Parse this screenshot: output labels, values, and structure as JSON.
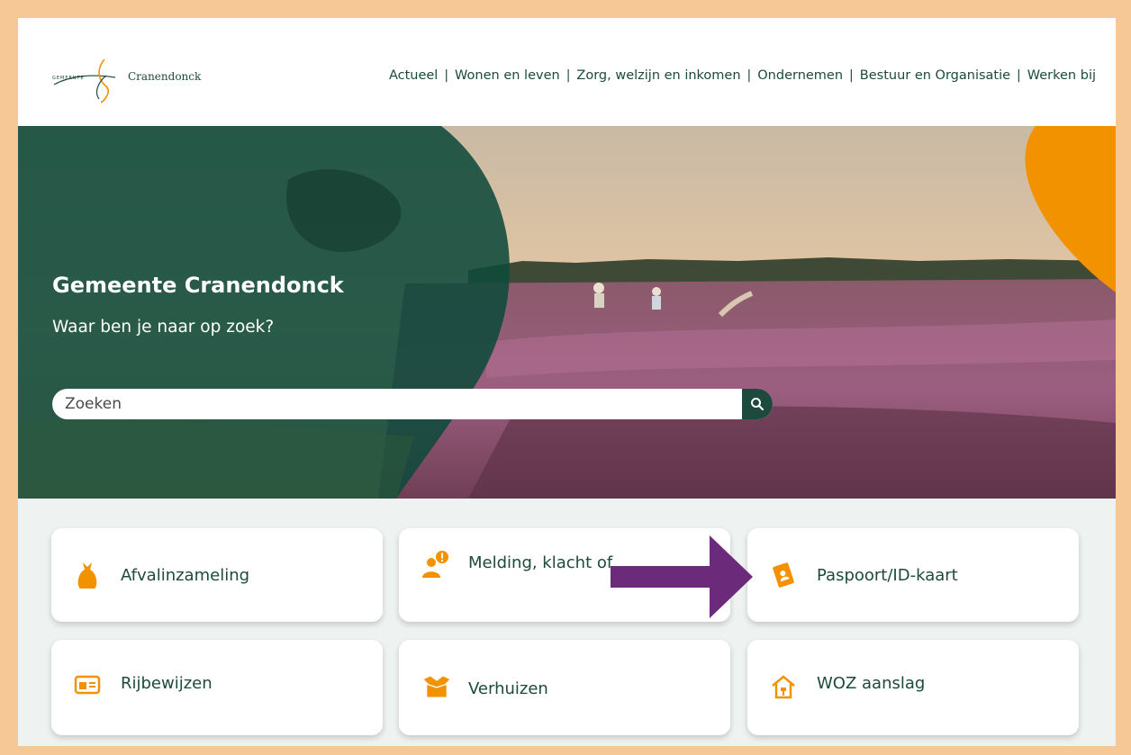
{
  "header": {
    "logo": {
      "small_text": "GEMEENTE",
      "wordmark": "Cranendonck"
    },
    "nav": [
      {
        "label": "Actueel"
      },
      {
        "label": "Wonen en leven"
      },
      {
        "label": "Zorg, welzijn en inkomen"
      },
      {
        "label": "Ondernemen"
      },
      {
        "label": "Bestuur en Organisatie"
      },
      {
        "label": "Werken bij"
      }
    ],
    "separator": "|"
  },
  "hero": {
    "title": "Gemeente Cranendonck",
    "subtitle": "Waar ben je naar op zoek?",
    "search": {
      "placeholder": "Zoeken",
      "value": ""
    }
  },
  "tiles": [
    {
      "label": "Afvalinzameling",
      "icon": "garbage-bag-icon"
    },
    {
      "label": "Melding, klacht of",
      "icon": "report-person-icon"
    },
    {
      "label": "Paspoort/ID-kaart",
      "icon": "passport-icon"
    },
    {
      "label": "Rijbewijzen",
      "icon": "id-card-icon"
    },
    {
      "label": "Verhuizen",
      "icon": "moving-box-icon"
    },
    {
      "label": "WOZ aanslag",
      "icon": "house-icon"
    }
  ],
  "colors": {
    "brand_green": "#1d4a3c",
    "accent_orange": "#f39200",
    "annotation_arrow": "#6b2a7a",
    "frame": "#f5c896"
  }
}
